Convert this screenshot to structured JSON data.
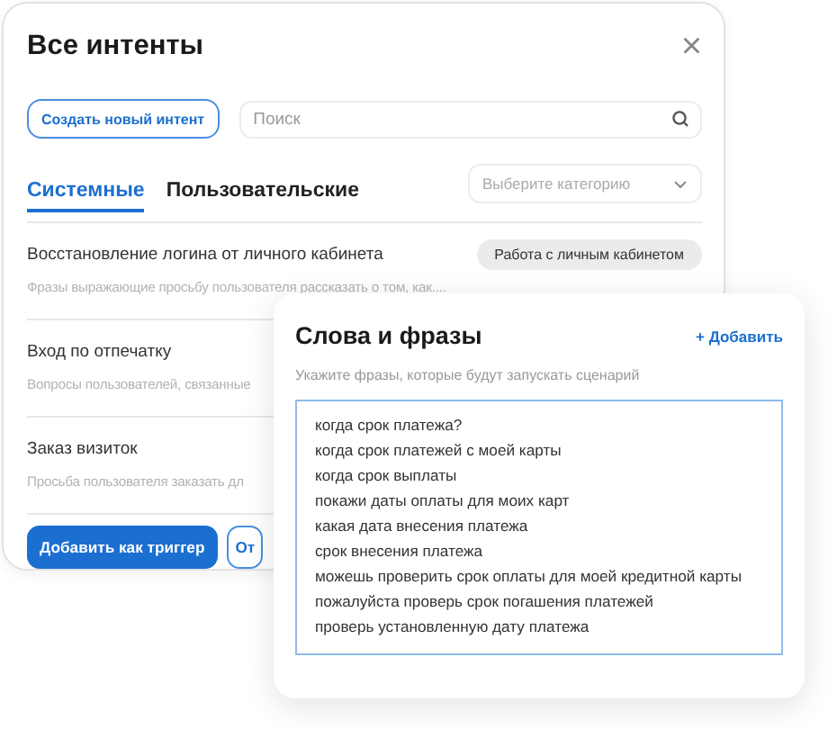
{
  "dialog": {
    "title": "Все интенты",
    "close": "×",
    "create_button": "Создать новый интент",
    "search": {
      "placeholder": "Поиск"
    },
    "tabs": [
      {
        "label": "Системные",
        "selected": true
      },
      {
        "label": "Пользовательские",
        "selected": false
      }
    ],
    "category": {
      "placeholder": "Выберите категорию"
    },
    "intents": [
      {
        "title": "Восстановление логина от личного кабинета",
        "tag": "Работа с личным кабинетом",
        "description": "Фразы выражающие просьбу пользователя рассказать о том, как...."
      },
      {
        "title": "Вход по отпечатку",
        "description": "Вопросы пользователей, связанные"
      },
      {
        "title": "Заказ визиток",
        "description": "Просьба пользователя заказать дл"
      }
    ],
    "buttons": [
      {
        "label": "Добавить как триггер",
        "kind": "primary"
      },
      {
        "label": "От",
        "kind": "outline"
      }
    ]
  },
  "phrases_card": {
    "title": "Слова и фразы",
    "add": "+ Добавить",
    "hint": "Укажите фразы, которые будут запускать сценарий",
    "phrases": [
      "когда срок платежа?",
      "когда срок платежей с моей карты",
      "когда срок выплаты",
      "покажи даты оплаты для моих карт",
      "какая дата внесения платежа",
      "срок внесения платежа",
      "можешь проверить срок оплаты для моей кредитной карты",
      "пожалуйста проверь срок погашения платежей",
      "проверь установленную дату платежа"
    ]
  }
}
